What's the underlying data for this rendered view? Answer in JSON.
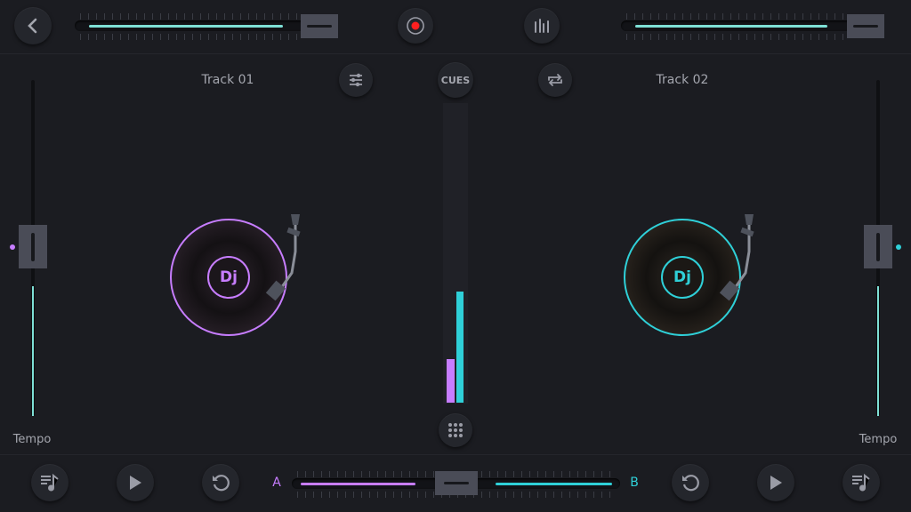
{
  "header": {
    "back_icon": "chevron-left-icon",
    "record_icon": "record-icon",
    "eq_icon": "equalizer-bars-icon"
  },
  "deck_a": {
    "title": "Track 01",
    "volume_percent": 80,
    "tempo_label": "Tempo",
    "tempo_percent": 50,
    "color": "#c77dff",
    "disc_label": "Dj"
  },
  "deck_b": {
    "title": "Track 02",
    "volume_percent": 80,
    "tempo_label": "Tempo",
    "tempo_percent": 50,
    "color": "#2fd0d8",
    "disc_label": "Dj"
  },
  "center": {
    "cues_label": "CUES",
    "mixer_icon": "sliders-icon",
    "loop_icon": "repeat-icon",
    "grid_icon": "grid-icon",
    "vu_a_level": 0.14,
    "vu_b_level": 0.37
  },
  "crossfader": {
    "label_a": "A",
    "label_b": "B",
    "position_percent": 50
  },
  "colors": {
    "background": "#1b1c21",
    "teal": "#7ee0d6",
    "magenta": "#c77dff",
    "cyan": "#2fd0d8",
    "record": "#ff2020"
  }
}
